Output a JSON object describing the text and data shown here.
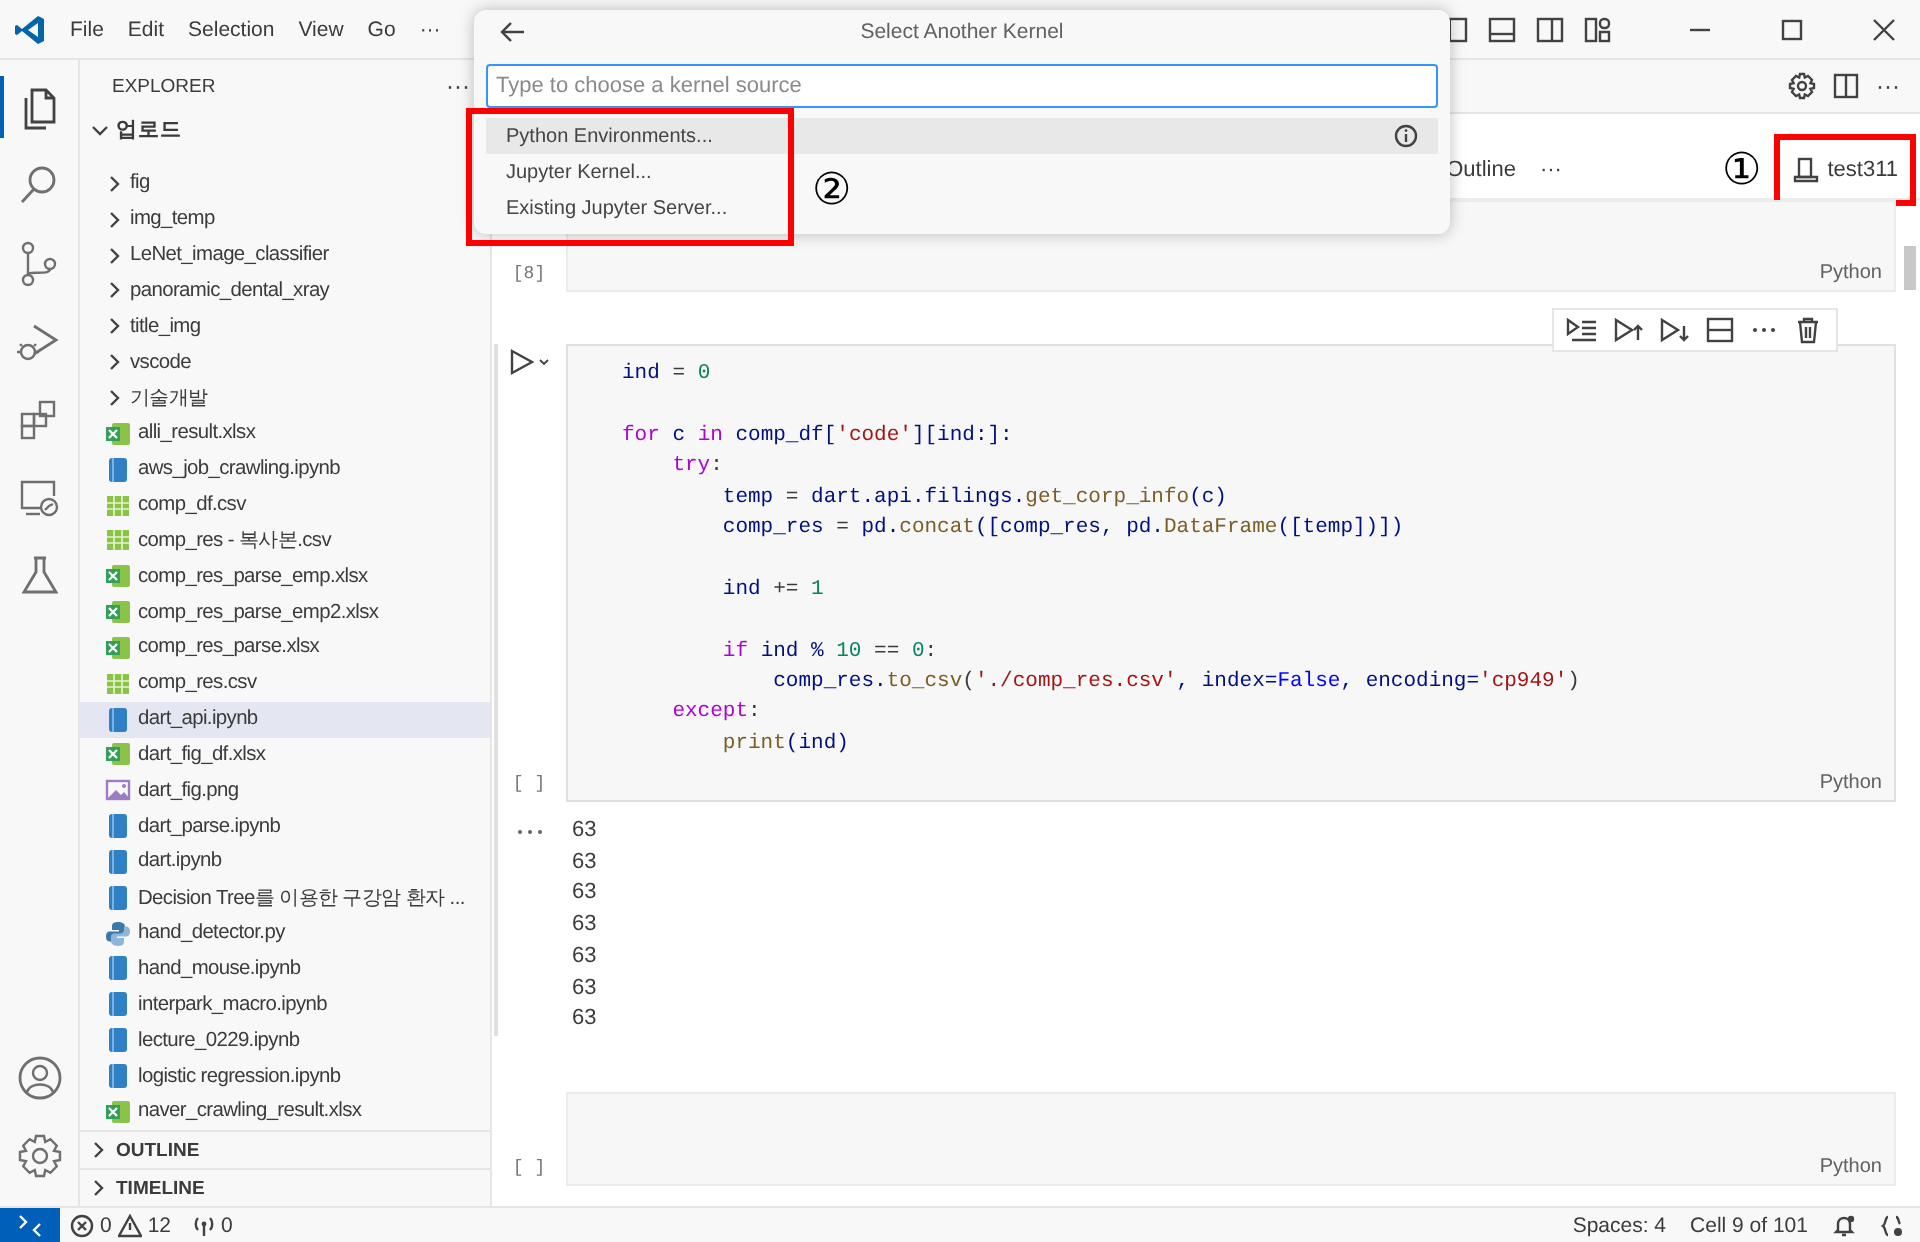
{
  "title_bar": {
    "menu": [
      "File",
      "Edit",
      "Selection",
      "View",
      "Go",
      "···"
    ]
  },
  "quick_pick": {
    "title": "Select Another Kernel",
    "placeholder": "Type to choose a kernel source",
    "outlined": true,
    "marker": "②",
    "items": [
      {
        "label": "Python Environments...",
        "selected": true
      },
      {
        "label": "Jupyter Kernel...",
        "selected": false
      },
      {
        "label": "Existing Jupyter Server...",
        "selected": false
      }
    ]
  },
  "activity_bar": {
    "top": [
      {
        "kind": "explorer",
        "selected": true
      },
      {
        "kind": "search",
        "selected": false
      },
      {
        "kind": "source-control",
        "selected": false
      },
      {
        "kind": "run-debug",
        "selected": false
      },
      {
        "kind": "extensions",
        "selected": false
      },
      {
        "kind": "remote",
        "selected": false
      },
      {
        "kind": "testing",
        "selected": false
      }
    ],
    "bottom": [
      {
        "kind": "account"
      },
      {
        "kind": "settings"
      }
    ]
  },
  "sidebar": {
    "title": "EXPLORER",
    "more": "···",
    "folder": {
      "label": "업로드",
      "expanded": true,
      "items": [
        {
          "kind": "folder",
          "label": "fig",
          "selected": false
        },
        {
          "kind": "folder",
          "label": "img_temp",
          "selected": false
        },
        {
          "kind": "folder",
          "label": "LeNet_image_classifier",
          "selected": false
        },
        {
          "kind": "folder",
          "label": "panoramic_dental_xray",
          "selected": false
        },
        {
          "kind": "folder",
          "label": "title_img",
          "selected": false
        },
        {
          "kind": "folder",
          "label": "vscode",
          "selected": false
        },
        {
          "kind": "folder",
          "label": "기술개발",
          "selected": false
        },
        {
          "kind": "xlsx",
          "label": "alli_result.xlsx",
          "selected": false
        },
        {
          "kind": "ipynb",
          "label": "aws_job_crawling.ipynb",
          "selected": false
        },
        {
          "kind": "csv",
          "label": "comp_df.csv",
          "selected": false
        },
        {
          "kind": "csv",
          "label": "comp_res - 복사본.csv",
          "selected": false
        },
        {
          "kind": "xlsx",
          "label": "comp_res_parse_emp.xlsx",
          "selected": false
        },
        {
          "kind": "xlsx",
          "label": "comp_res_parse_emp2.xlsx",
          "selected": false
        },
        {
          "kind": "xlsx",
          "label": "comp_res_parse.xlsx",
          "selected": false
        },
        {
          "kind": "csv",
          "label": "comp_res.csv",
          "selected": false
        },
        {
          "kind": "ipynb",
          "label": "dart_api.ipynb",
          "selected": true
        },
        {
          "kind": "xlsx",
          "label": "dart_fig_df.xlsx",
          "selected": false
        },
        {
          "kind": "png",
          "label": "dart_fig.png",
          "selected": false
        },
        {
          "kind": "ipynb",
          "label": "dart_parse.ipynb",
          "selected": false
        },
        {
          "kind": "ipynb",
          "label": "dart.ipynb",
          "selected": false
        },
        {
          "kind": "ipynb",
          "label": "Decision Tree를 이용한 구강암 환자 ...",
          "selected": false
        },
        {
          "kind": "py",
          "label": "hand_detector.py",
          "selected": false
        },
        {
          "kind": "ipynb",
          "label": "hand_mouse.ipynb",
          "selected": false
        },
        {
          "kind": "ipynb",
          "label": "interpark_macro.ipynb",
          "selected": false
        },
        {
          "kind": "ipynb",
          "label": "lecture_0229.ipynb",
          "selected": false
        },
        {
          "kind": "ipynb",
          "label": "logistic regression.ipynb",
          "selected": false
        },
        {
          "kind": "xlsx",
          "label": "naver_crawling_result.xlsx",
          "selected": false
        }
      ]
    },
    "sections": [
      {
        "label": "OUTLINE",
        "expanded": false
      },
      {
        "label": "TIMELINE",
        "expanded": false
      }
    ]
  },
  "editor_actions": {
    "more": "···"
  },
  "editor": {
    "toolbar": {
      "outline": "Outline",
      "more": "···",
      "kernel": {
        "label": "test311",
        "outlined": true,
        "marker": "①"
      }
    },
    "cells": [
      {
        "kind": "code",
        "exec": "[8]",
        "language": "Python",
        "focused": false
      },
      {
        "kind": "code",
        "exec": "[ ]",
        "language": "Python",
        "focused": true,
        "lines": [
          {
            "kind": "code",
            "tokens": [
              {
                "t": "ind",
                "kind": "var"
              },
              {
                "t": " = ",
                "kind": "plain"
              },
              {
                "t": "0",
                "kind": "num"
              }
            ]
          },
          {
            "kind": "blank"
          },
          {
            "kind": "code",
            "tokens": [
              {
                "t": "for",
                "kind": "kw"
              },
              {
                "t": " c ",
                "kind": "var"
              },
              {
                "t": "in",
                "kind": "kw"
              },
              {
                "t": " comp_df[",
                "kind": "var"
              },
              {
                "t": "'code'",
                "kind": "str"
              },
              {
                "t": "][ind:]:",
                "kind": "var"
              }
            ]
          },
          {
            "kind": "code",
            "tokens": [
              {
                "t": "    try",
                "kind": "kw"
              },
              {
                "t": ":",
                "kind": "plain"
              }
            ]
          },
          {
            "kind": "code",
            "tokens": [
              {
                "t": "        temp",
                "kind": "var"
              },
              {
                "t": " = ",
                "kind": "plain"
              },
              {
                "t": "dart.api.filings.",
                "kind": "var"
              },
              {
                "t": "get_corp_info",
                "kind": "fn"
              },
              {
                "t": "(c)",
                "kind": "var"
              }
            ]
          },
          {
            "kind": "code",
            "tokens": [
              {
                "t": "        comp_res",
                "kind": "var"
              },
              {
                "t": " = ",
                "kind": "plain"
              },
              {
                "t": "pd.",
                "kind": "var"
              },
              {
                "t": "concat",
                "kind": "fn"
              },
              {
                "t": "([comp_res, pd.",
                "kind": "var"
              },
              {
                "t": "DataFrame",
                "kind": "fn"
              },
              {
                "t": "([temp])])",
                "kind": "var"
              }
            ]
          },
          {
            "kind": "blank"
          },
          {
            "kind": "code",
            "tokens": [
              {
                "t": "        ind",
                "kind": "var"
              },
              {
                "t": " += ",
                "kind": "plain"
              },
              {
                "t": "1",
                "kind": "num"
              }
            ]
          },
          {
            "kind": "blank"
          },
          {
            "kind": "code",
            "tokens": [
              {
                "t": "        if",
                "kind": "kw"
              },
              {
                "t": " ind % ",
                "kind": "var"
              },
              {
                "t": "10",
                "kind": "num"
              },
              {
                "t": " == ",
                "kind": "plain"
              },
              {
                "t": "0",
                "kind": "num"
              },
              {
                "t": ":",
                "kind": "plain"
              }
            ]
          },
          {
            "kind": "code",
            "tokens": [
              {
                "t": "            comp_res.",
                "kind": "var"
              },
              {
                "t": "to_csv",
                "kind": "fn"
              },
              {
                "t": "(",
                "kind": "plain"
              },
              {
                "t": "'./comp_res.csv'",
                "kind": "str"
              },
              {
                "t": ", index=",
                "kind": "var"
              },
              {
                "t": "False",
                "kind": "const"
              },
              {
                "t": ", encoding=",
                "kind": "var"
              },
              {
                "t": "'cp949'",
                "kind": "str"
              },
              {
                "t": ")",
                "kind": "plain"
              }
            ]
          },
          {
            "kind": "code",
            "tokens": [
              {
                "t": "    except",
                "kind": "kw"
              },
              {
                "t": ":",
                "kind": "plain"
              }
            ]
          },
          {
            "kind": "code",
            "tokens": [
              {
                "t": "        print",
                "kind": "fn"
              },
              {
                "t": "(ind)",
                "kind": "var"
              }
            ]
          }
        ],
        "outputs": [
          "63",
          "63",
          "63",
          "63",
          "63",
          "63",
          "63"
        ]
      },
      {
        "kind": "code",
        "exec": "[ ]",
        "language": "Python",
        "focused": false
      }
    ]
  },
  "status_bar": {
    "errors": "0",
    "warnings": "12",
    "ports": "0",
    "spaces": "Spaces: 4",
    "cell": "Cell 9 of 101"
  }
}
